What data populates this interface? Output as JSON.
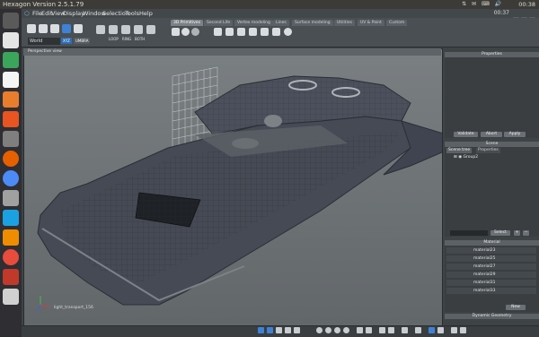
{
  "window": {
    "title": "Hexagon Version 2.5.1.79"
  },
  "system": {
    "clock": "00:38",
    "app_clock": "00:37"
  },
  "menu": [
    "File",
    "Edit",
    "View",
    "Display",
    "Window",
    "Selection",
    "Tools",
    "Help"
  ],
  "tabs": [
    {
      "label": "3D Primitives",
      "active": true
    },
    {
      "label": "Second Life",
      "active": false
    },
    {
      "label": "Vertex modeling",
      "active": false
    },
    {
      "label": "Lines",
      "active": false
    },
    {
      "label": "Surface modeling",
      "active": false
    },
    {
      "label": "Utilities",
      "active": false
    },
    {
      "label": "UV & Paint",
      "active": false
    },
    {
      "label": "Custom",
      "active": false
    }
  ],
  "toolbar": {
    "coord_system": "World",
    "xyz_label": "XYZ",
    "umbra_label": "UMBRA",
    "loop_label": "LOOP",
    "ring_label": "RING",
    "both_label": "BOTH"
  },
  "viewport": {
    "title": "Perspective view",
    "object_label": "light_transport_156"
  },
  "properties": {
    "title": "Properties",
    "validate": "Validate",
    "abort": "Abort",
    "apply": "Apply"
  },
  "scene": {
    "title": "Scene",
    "tab_tree": "Scene tree",
    "tab_props": "Properties",
    "item": "Group2",
    "select_button": "Select"
  },
  "material": {
    "title": "Material",
    "items": [
      "material23",
      "material25",
      "material27",
      "material29",
      "material31",
      "material33"
    ],
    "new_button": "New"
  },
  "dynamic_geometry": {
    "title": "Dynamic Geometry"
  }
}
